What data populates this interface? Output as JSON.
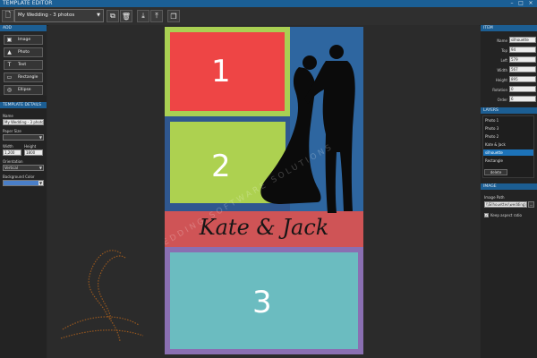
{
  "window": {
    "title": "TEMPLATE EDITOR",
    "min": "–",
    "max": "□",
    "close": "×"
  },
  "toolbar": {
    "template_select": "My Wedding - 3 photos"
  },
  "tools": {
    "header": "ADD",
    "items": [
      {
        "label": "Image",
        "icon": "image-icon",
        "glyph": "▣"
      },
      {
        "label": "Photo",
        "icon": "photo-icon",
        "glyph": "▲"
      },
      {
        "label": "Text",
        "icon": "text-icon",
        "glyph": "T"
      },
      {
        "label": "Rectangle",
        "icon": "rectangle-icon",
        "glyph": "▭"
      },
      {
        "label": "Ellipse",
        "icon": "ellipse-icon",
        "glyph": "◎"
      }
    ]
  },
  "template_details": {
    "header": "TEMPLATE DETAILS",
    "name_label": "Name",
    "name_value": "My Wedding - 3 photos",
    "paper_size_label": "Paper Size",
    "paper_size_value": "",
    "width_label": "Width",
    "width_value": "1,200",
    "height_label": "Height",
    "height_value": "1800",
    "orientation_label": "Orientation",
    "orientation_value": "Vertical",
    "bg_color_label": "Background Color",
    "bg_color": "#4a7fc8"
  },
  "canvas": {
    "photo1_number": "1",
    "photo2_number": "2",
    "photo3_number": "3",
    "caption": "Kate & Jack",
    "watermark": "WEDDING SOFTWARE SOLUTIONS",
    "photo1_color": "#ee4545",
    "photo2_color": "#add150",
    "photo3_color": "#6bbcc0",
    "caption_color": "#cf5456",
    "doc_bg": "#2e66a0"
  },
  "item_props": {
    "header": "ITEM",
    "name_label": "Name",
    "name_value": "silhouette",
    "top_label": "Top",
    "top_value": "94",
    "left_label": "Left",
    "left_value": "579",
    "width_label": "Width",
    "width_value": "567",
    "height_label": "Height",
    "height_value": "895",
    "rotation_label": "Rotation",
    "rotation_value": "0",
    "order_label": "Order",
    "order_value": "6"
  },
  "layers": {
    "header": "LAYERS",
    "items": [
      "Photo 1",
      "Photo 3",
      "Photo 2",
      "Kate & Jack",
      "silhouette",
      "Rectangle"
    ],
    "selected_index": 4,
    "delete_label": "delete"
  },
  "image_props": {
    "header": "IMAGE",
    "path_label": "Image Path",
    "path_value": "\\\\Silhouettes\\wedding\\Bride-and",
    "browse_label": "...",
    "keep_aspect_label": "Keep aspect ratio",
    "keep_aspect_checked": true
  }
}
